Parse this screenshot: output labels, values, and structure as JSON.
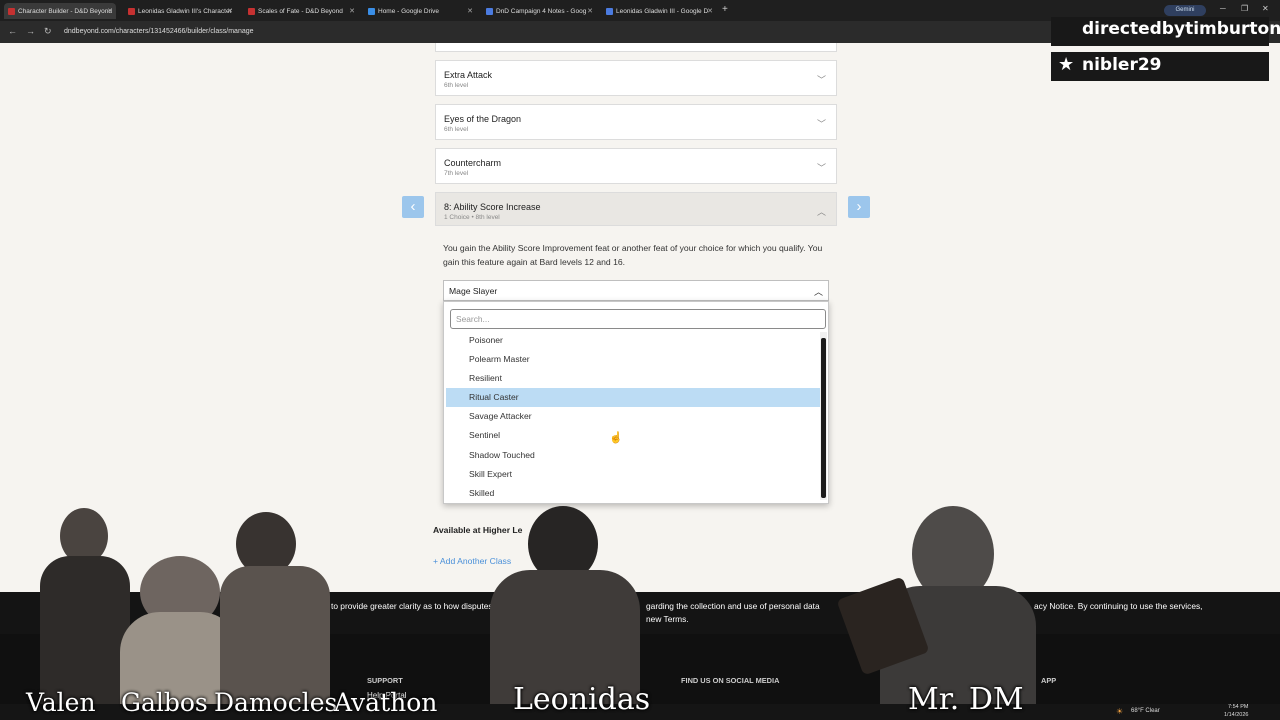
{
  "browser": {
    "tabs": [
      {
        "label": "Character Builder - D&D Beyond",
        "active": true
      },
      {
        "label": "Leonidas Gladwin III's Character",
        "active": false
      },
      {
        "label": "Scales of Fate - D&D Beyond",
        "active": false
      },
      {
        "label": "Home - Google Drive",
        "active": false
      },
      {
        "label": "DnD Campaign 4 Notes - Goog",
        "active": false
      },
      {
        "label": "Leonidas Gladwin III - Google D",
        "active": false
      }
    ],
    "new_tab": "+",
    "gemini_label": "Gemini",
    "url": "dndbeyond.com/characters/131452466/builder/class/manage"
  },
  "features": [
    {
      "title": "Extra Attack",
      "sub": "6th level"
    },
    {
      "title": "Eyes of the Dragon",
      "sub": "6th level"
    },
    {
      "title": "Countercharm",
      "sub": "7th level"
    }
  ],
  "asi": {
    "title": "8: Ability Score Increase",
    "sub": "1 Choice • 8th level",
    "description": "You gain the Ability Score Improvement feat or another feat of your choice for which you qualify. You gain this feature again at Bard levels 12 and 16.",
    "selected": "Mage Slayer",
    "search_placeholder": "Search...",
    "options": [
      "Poisoner",
      "Polearm Master",
      "Resilient",
      "Ritual Caster",
      "Savage Attacker",
      "Sentinel",
      "Shadow Touched",
      "Skill Expert",
      "Skilled"
    ],
    "highlighted": "Ritual Caster"
  },
  "higher_level_label": "Available at Higher Le",
  "add_class_label": "+ Add Another Class",
  "cookie": {
    "part1": "to provide greater clarity as to how disputes are h",
    "part2": "garding the collection and use of personal data",
    "part3": "new Terms.",
    "part4": "acy Notice. By continuing to use the services,"
  },
  "footer": {
    "support_heading": "SUPPORT",
    "help_portal": "Help Portal",
    "social_heading": "FIND US ON SOCIAL MEDIA",
    "app_heading": "APP"
  },
  "overlay": {
    "banner_top": "directedbytimburton",
    "banner_bottom": "nibler29",
    "names": [
      "Valen",
      "Galbos",
      "Damocles",
      "Avathon",
      "Leonidas",
      "Mr. DM"
    ]
  },
  "taskbar": {
    "weather": "68°F Clear",
    "time": "7:54 PM",
    "date": "1/14/2026"
  },
  "colors": {
    "accent_blue": "#4a90d9",
    "highlight": "#bcdcf4",
    "nav_arrow": "#9cc6ec"
  }
}
